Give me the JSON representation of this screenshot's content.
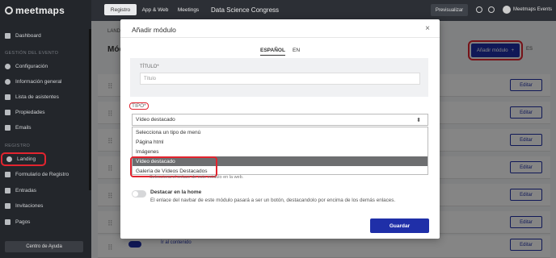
{
  "app": {
    "logo_text": "meetmaps"
  },
  "sidebar": {
    "items": [
      {
        "label": "Dashboard",
        "icon": "dashboard-icon"
      },
      {
        "label": "Configuración",
        "icon": "gear-icon"
      },
      {
        "label": "Información general",
        "icon": "info-icon"
      },
      {
        "label": "Lista de asistentes",
        "icon": "list-icon"
      },
      {
        "label": "Propiedades",
        "icon": "properties-icon"
      },
      {
        "label": "Emails",
        "icon": "mail-icon"
      },
      {
        "label": "Landing",
        "icon": "globe-icon"
      },
      {
        "label": "Formulario de Registro",
        "icon": "form-icon"
      },
      {
        "label": "Entradas",
        "icon": "ticket-icon"
      },
      {
        "label": "Invitaciones",
        "icon": "invite-icon"
      },
      {
        "label": "Pagos",
        "icon": "card-icon"
      }
    ],
    "sections": {
      "event": "GESTIÓN DEL EVENTO",
      "registry": "REGISTRO"
    },
    "help_label": "Centro de Ayuda"
  },
  "topbar": {
    "tabs": [
      "Registro",
      "App & Web",
      "Meetings"
    ],
    "event_name": "Data Science Congress",
    "preview_label": "Previsualizar",
    "user_name": "Meetmaps Events"
  },
  "background": {
    "tab_label": "LAND",
    "title": "Móc",
    "add_module_label": "Añadir módulo",
    "lang_label": "ES",
    "edit_label": "Editar",
    "link_label": "Ir al contenido"
  },
  "modal": {
    "title": "Añadir módulo",
    "close": "×",
    "lang_tabs": [
      "ESPAÑOL",
      "EN"
    ],
    "title_label": "TÍTULO*",
    "title_placeholder": "Título",
    "tipo_label": "TIPO*",
    "tipo_value": "Vídeo destacado",
    "dropdown_options": [
      "Selecciona un tipo de menú",
      "Página html",
      "Imágenes",
      "Vídeo destacado",
      "Galería de Vídeos Destacados"
    ],
    "selected_option_index": 3,
    "helper_text": "Selecciona el enlace de este módulo en la web.",
    "destacar_title": "Destacar en la home",
    "destacar_desc": "El enlace del navbar de este módulo pasará a ser un botón, destacandolo por encima de los demás enlaces.",
    "save_label": "Guardar"
  },
  "colors": {
    "accent": "#1f2fa8",
    "highlight": "#e2242f",
    "sidebar_bg": "#23262b"
  }
}
